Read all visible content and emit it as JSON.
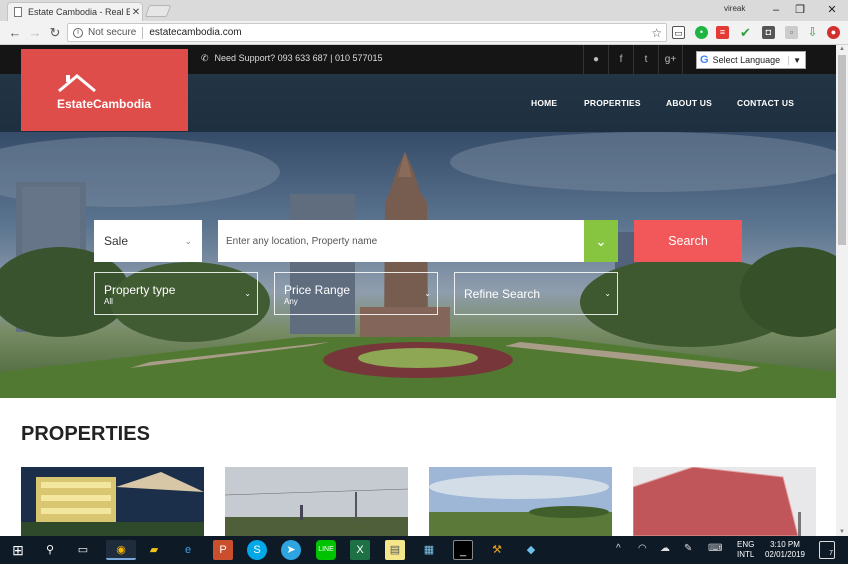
{
  "browser": {
    "tab_title": "Estate Cambodia - Real E",
    "tab_close": "✕",
    "profile": "vireak",
    "security_label": "Not secure",
    "url": "estatecambodia.com"
  },
  "site": {
    "support_text": "Need Support? 093 633 687 | 010 577015",
    "language_label": "Select Language",
    "brand": "EstateCambodia",
    "nav": [
      "HOME",
      "PROPERTIES",
      "ABOUT US",
      "CONTACT US"
    ],
    "search": {
      "type_selected": "Sale",
      "location_placeholder": "Enter any location, Property name",
      "button": "Search",
      "filters": [
        {
          "label": "Property type",
          "value": "All"
        },
        {
          "label": "Price Range",
          "value": "Any"
        },
        {
          "label": "Refine Search",
          "value": ""
        }
      ]
    },
    "section_title": "PROPERTIES"
  },
  "taskbar": {
    "lang_line1": "ENG",
    "lang_line2": "INTL",
    "time": "3:10 PM",
    "date": "02/01/2019",
    "notifications": "7"
  },
  "colors": {
    "logo": "#df4d4b",
    "search_button": "#f2575a",
    "toggle": "#87c540",
    "nav_band": "#233444"
  }
}
